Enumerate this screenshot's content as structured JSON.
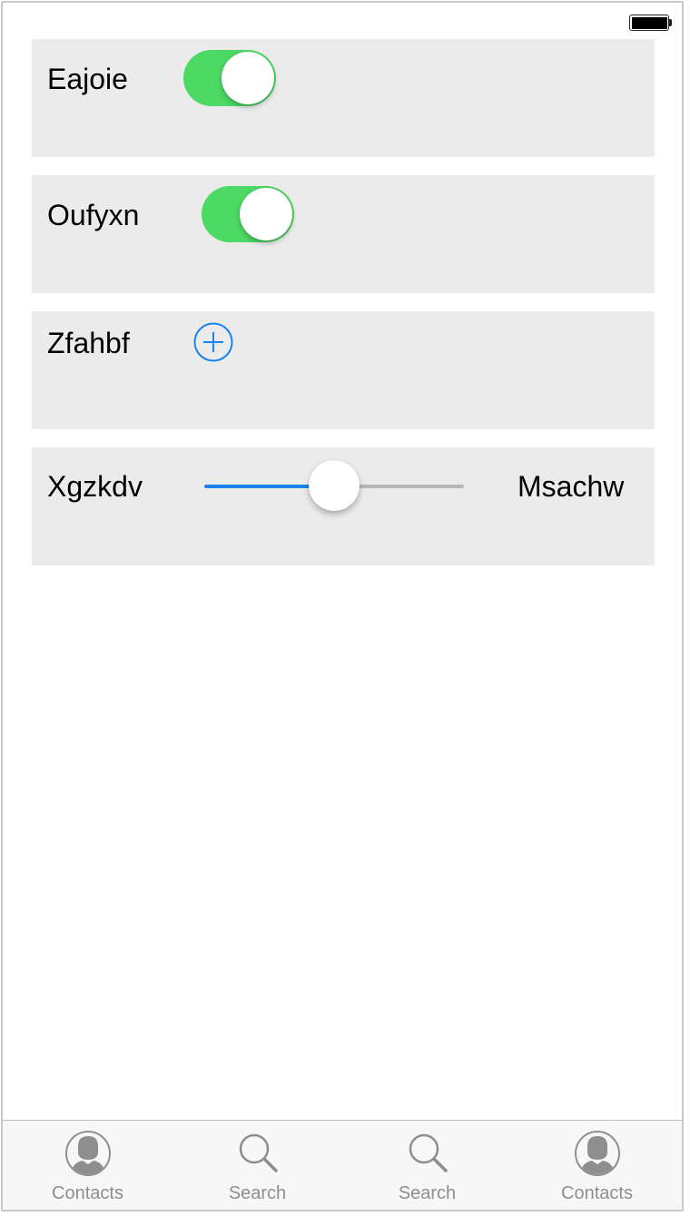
{
  "status_bar": {
    "battery_icon": "battery-full-icon"
  },
  "rows": [
    {
      "label": "Eajoie",
      "control": "toggle",
      "on": true
    },
    {
      "label": "Oufyxn",
      "control": "toggle",
      "on": true
    },
    {
      "label": "Zfahbf",
      "control": "add-button",
      "icon": "plus-circle-icon"
    },
    {
      "label": "Xgzkdv",
      "control": "slider",
      "value": 0.5,
      "trailing_label": "Msachw"
    }
  ],
  "tab_bar": {
    "items": [
      {
        "label": "Contacts",
        "icon": "contacts-icon"
      },
      {
        "label": "Search",
        "icon": "search-icon"
      },
      {
        "label": "Search",
        "icon": "search-icon"
      },
      {
        "label": "Contacts",
        "icon": "contacts-icon"
      }
    ]
  },
  "colors": {
    "toggle_on": "#4cd964",
    "accent": "#1a82f1",
    "card_bg": "#ebebeb",
    "tab_inactive": "#8e8e8e"
  }
}
